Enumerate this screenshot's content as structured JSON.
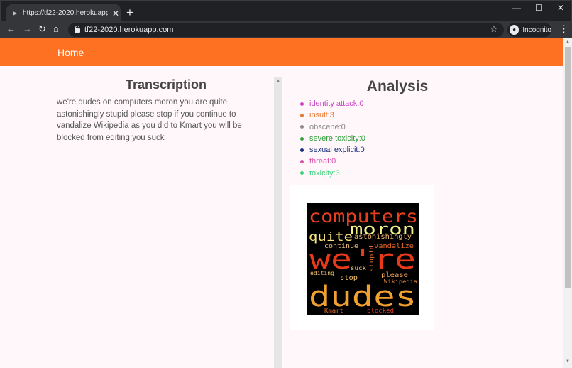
{
  "browser": {
    "tab_title": "https://tf22-2020.herokuapp.com",
    "url": "tf22-2020.herokuapp.com",
    "profile_label": "Incognito"
  },
  "nav": {
    "home_label": "Home"
  },
  "transcription": {
    "heading": "Transcription",
    "text": "we're dudes on computers moron you are quite astonishingly stupid please stop if you continue to vandalize Wikipedia as you did to Kmart you will be blocked from editing you suck"
  },
  "analysis": {
    "heading": "Analysis",
    "labels": [
      {
        "text": "identity attack:0",
        "color": "#c744c7"
      },
      {
        "text": "insult:3",
        "color": "#e8772e"
      },
      {
        "text": "obscene:0",
        "color": "#8a8a8a"
      },
      {
        "text": "severe toxicity:0",
        "color": "#2e9e3a"
      },
      {
        "text": "sexual explicit:0",
        "color": "#16307a"
      },
      {
        "text": "threat:0",
        "color": "#d94fb0"
      },
      {
        "text": "toxicity:3",
        "color": "#3ad17a"
      }
    ]
  },
  "wordcloud": {
    "words": [
      "computers",
      "moron",
      "quite",
      "astonishingly",
      "continue",
      "vandalize",
      "stupid",
      "we're",
      "suck",
      "please",
      "editing",
      "stop",
      "Wikipedia",
      "dudes",
      "Kmart",
      "blocked"
    ]
  }
}
